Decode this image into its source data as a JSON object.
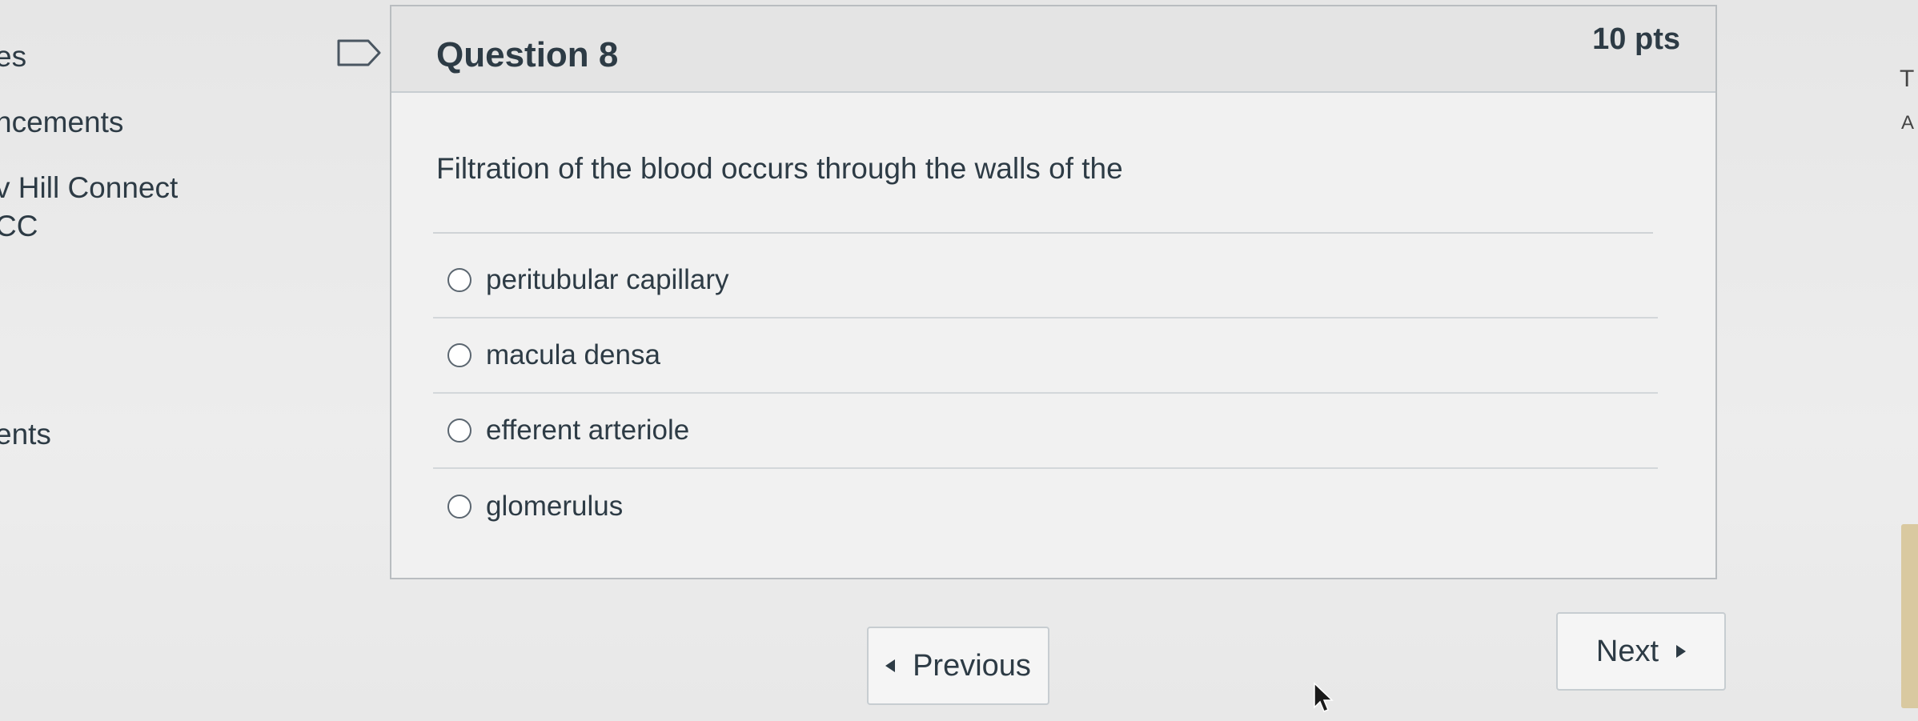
{
  "left_nav": {
    "items": [
      "es",
      "ncements",
      "v Hill Connect",
      "CC",
      "ents"
    ]
  },
  "right_strip": {
    "fragments": [
      "T",
      "A"
    ]
  },
  "question": {
    "title": "Question 8",
    "points": "10 pts",
    "text": "Filtration of the blood occurs through the walls of the",
    "answers": [
      "peritubular capillary",
      "macula densa",
      "efferent arteriole",
      "glomerulus"
    ],
    "selected_answer": null
  },
  "navigation": {
    "previous_label": "Previous",
    "next_label": "Next"
  },
  "colors": {
    "text": "#2d3b45",
    "card_border": "#b9bdc0",
    "header_bg": "#e4e4e4"
  }
}
